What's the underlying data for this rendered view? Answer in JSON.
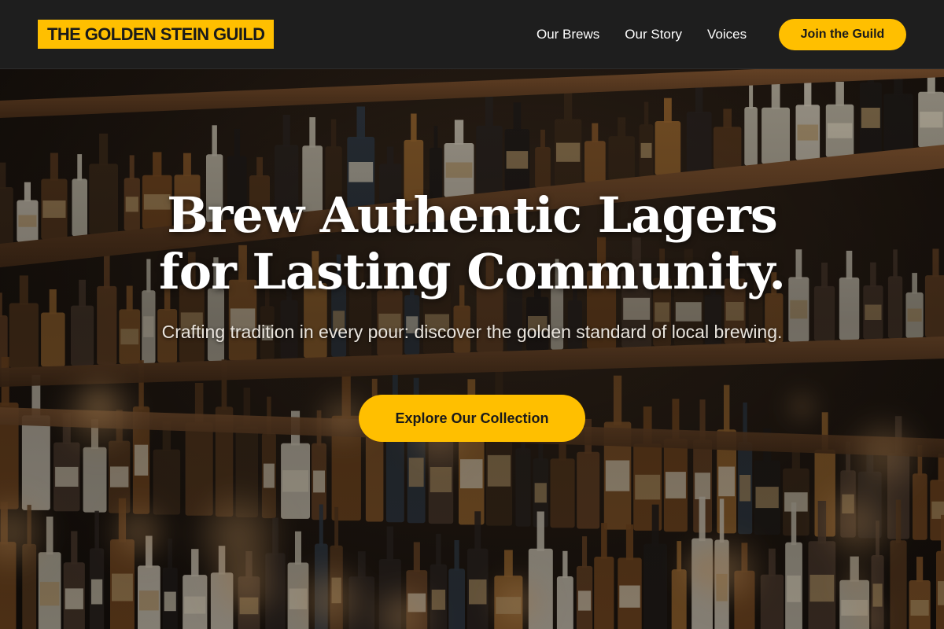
{
  "nav": {
    "brand": "THE GOLDEN STEIN GUILD",
    "links": [
      "Our Brews",
      "Our Story",
      "Voices"
    ],
    "cta_label": "Join the Guild"
  },
  "hero": {
    "headline_line1": "Brew Authentic Lagers",
    "headline_line2": "for Lasting Community.",
    "subtitle": "Crafting tradition in every pour: discover the golden standard of local brewing.",
    "cta_label": "Explore Our Collection",
    "background_image": "bar-shelves-with-bottles"
  },
  "colors": {
    "accent": "#ffbf00",
    "nav_background": "#1e1e1e",
    "headline_text": "#ffffff",
    "button_text": "#1a1a1a"
  }
}
